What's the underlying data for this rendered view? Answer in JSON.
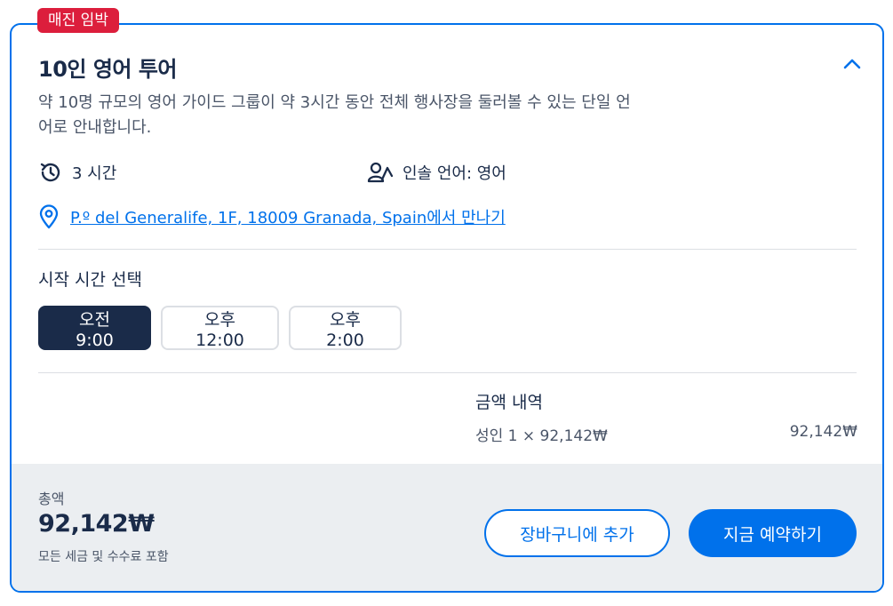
{
  "badge": "매진 임박",
  "option": {
    "title": "10인 영어 투어",
    "description": "약 10명 규모의 영어 가이드 그룹이 약 3시간 동안 전체 행사장을 둘러볼 수 있는 단일 언어로 안내합니다.",
    "duration": "3 시간",
    "language": "인솔 언어: 영어",
    "meeting_point_link": "P.º del Generalife, 1F, 18009 Granada, Spain",
    "meeting_point_suffix": "에서 만나기"
  },
  "start_time": {
    "label": "시작 시간 선택",
    "options": [
      "오전 9:00",
      "오후 12:00",
      "오후 2:00"
    ],
    "selected": "오전 9:00"
  },
  "price_breakdown": {
    "title": "금액 내역",
    "line_label": "성인 1 × 92,142₩",
    "line_value": "92,142₩"
  },
  "footer": {
    "total_label": "총액",
    "total_amount": "92,142₩",
    "tax_note": "모든 세금 및 수수료 포함",
    "add_to_cart": "장바구니에 추가",
    "book_now": "지금 예약하기"
  },
  "colors": {
    "accent": "#0071eb",
    "navy": "#1a2b49",
    "badge_red": "#dc1e3c",
    "footer_bg": "#ebeef1"
  },
  "icons": [
    "chevron-up-icon",
    "clock-history-icon",
    "guide-language-icon",
    "location-pin-icon"
  ]
}
